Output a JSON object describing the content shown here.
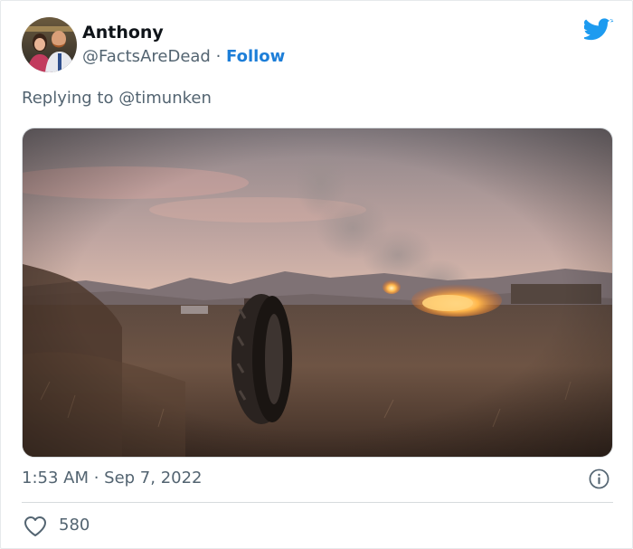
{
  "author": {
    "name": "Anthony",
    "handle": "@FactsAreDead",
    "separator": " · ",
    "follow_label": "Follow"
  },
  "reply": {
    "text": "Replying to @timunken"
  },
  "media": {
    "description_icon": "photo-tire-in-desert-with-fire"
  },
  "meta": {
    "timestamp": "1:53 AM · Sep 7, 2022"
  },
  "engagement": {
    "likes": "580"
  },
  "colors": {
    "brand": "#1d9bf0",
    "follow": "#1d7ed8",
    "secondary_text": "#536471"
  }
}
